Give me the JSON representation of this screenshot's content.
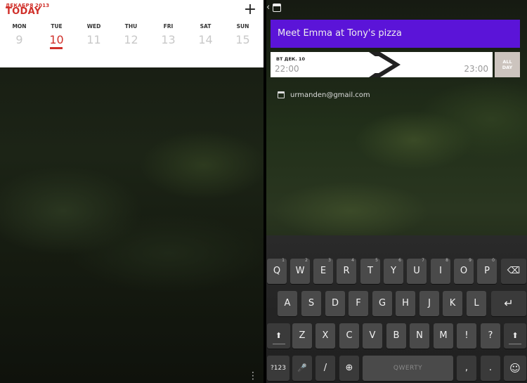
{
  "left": {
    "month_label": "ДЕКАБРЯ 2013",
    "today_label": "TODAY",
    "add_icon": "plus-icon",
    "add_glyph": "+",
    "days": [
      {
        "name": "MON",
        "num": "9"
      },
      {
        "name": "TUE",
        "num": "10"
      },
      {
        "name": "WED",
        "num": "11"
      },
      {
        "name": "THU",
        "num": "12"
      },
      {
        "name": "FRI",
        "num": "13"
      },
      {
        "name": "SAT",
        "num": "14"
      },
      {
        "name": "SUN",
        "num": "15"
      }
    ],
    "active_day": "TUE",
    "overflow_icon": "more-vertical-icon",
    "overflow_glyph": "⋮"
  },
  "right": {
    "back_icon": "back-chevron-icon",
    "back_glyph": "‹",
    "app_icon": "calendar-app-icon",
    "event_title": "Meet Emma at Tony's pizza",
    "start_date": "ВТ ДЕК. 10",
    "start_time": "22:00",
    "end_time": "23:00",
    "allday_line1": "ALL",
    "allday_line2": "DAY",
    "account_icon": "calendar-icon",
    "account_email": "urmanden@gmail.com"
  },
  "colors": {
    "accent_red": "#d0302a",
    "title_purple": "#5b14d8",
    "allday_bg": "#ccc4be",
    "key_bg": "#4a4a4a"
  },
  "keyboard": {
    "row1": [
      {
        "k": "Q",
        "h": "1"
      },
      {
        "k": "W",
        "h": "2"
      },
      {
        "k": "E",
        "h": "3"
      },
      {
        "k": "R",
        "h": "4"
      },
      {
        "k": "T",
        "h": "5"
      },
      {
        "k": "Y",
        "h": "6"
      },
      {
        "k": "U",
        "h": "7"
      },
      {
        "k": "I",
        "h": "8"
      },
      {
        "k": "O",
        "h": "9"
      },
      {
        "k": "P",
        "h": "0"
      }
    ],
    "backspace_icon": "backspace-icon",
    "backspace_glyph": "⌫",
    "row2": [
      "A",
      "S",
      "D",
      "F",
      "G",
      "H",
      "J",
      "K",
      "L"
    ],
    "enter_icon": "enter-icon",
    "enter_glyph": "↵",
    "shift_icon": "shift-icon",
    "shift_glyph": "⬆",
    "row3": [
      "Z",
      "X",
      "C",
      "V",
      "B",
      "N",
      "M",
      "!",
      "?"
    ],
    "symbols_label": "?123",
    "mic_icon": "microphone-icon",
    "mic_glyph": "🎤",
    "slash_label": "/",
    "globe_icon": "globe-icon",
    "globe_glyph": "⊕",
    "space_label": "QWERTY",
    "comma_label": ",",
    "period_label": ".",
    "emoji_icon": "emoji-icon",
    "emoji_glyph": "☺"
  }
}
